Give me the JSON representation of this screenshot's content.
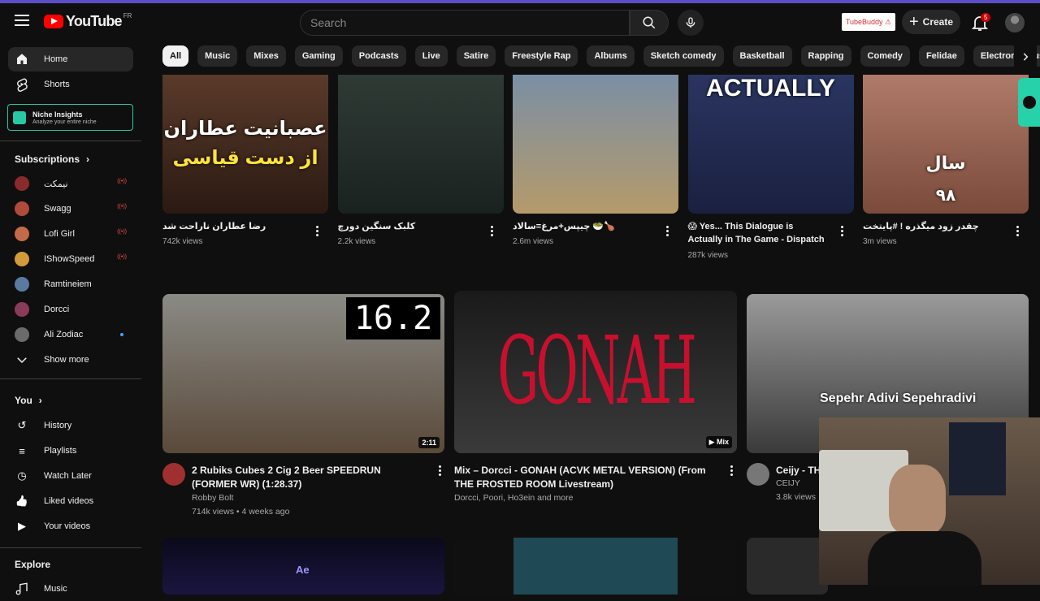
{
  "header": {
    "logo_text": "YouTube",
    "country": "FR",
    "search_placeholder": "Search",
    "tubebuddy_label": "TubeBuddy ⚠",
    "create_label": "Create",
    "notification_count": "5"
  },
  "sidebar": {
    "home": "Home",
    "shorts": "Shorts",
    "niche_title": "Niche Insights",
    "niche_subtitle": "Analyze your entire niche",
    "subscriptions_title": "Subscriptions",
    "subscriptions": [
      {
        "name": "نیمکت",
        "live": true,
        "color": "#8a2b2b"
      },
      {
        "name": "Swagg",
        "live": true,
        "color": "#b04a3a"
      },
      {
        "name": "Lofi Girl",
        "live": true,
        "color": "#c46a4a"
      },
      {
        "name": "IShowSpeed",
        "live": true,
        "color": "#d49b3a"
      },
      {
        "name": "Ramtineiem",
        "live": false,
        "color": "#5a7aa0"
      },
      {
        "name": "Dorcci",
        "live": false,
        "color": "#8b3b5a"
      },
      {
        "name": "Ali Zodiac",
        "live": false,
        "color": "#6b6b6b"
      }
    ],
    "show_more": "Show more",
    "you_title": "You",
    "you_items": [
      "History",
      "Playlists",
      "Watch Later",
      "Liked videos",
      "Your videos"
    ],
    "explore_title": "Explore",
    "explore_partial": "Music"
  },
  "chips": [
    "All",
    "Music",
    "Mixes",
    "Gaming",
    "Podcasts",
    "Live",
    "Satire",
    "Freestyle Rap",
    "Albums",
    "Sketch comedy",
    "Basketball",
    "Rapping",
    "Comedy",
    "Felidae",
    "Electronic Music"
  ],
  "shorts": [
    {
      "title": "رضا عطاران ناراحت شد",
      "views": "742k views",
      "thumb_text_1": "عصبانیت عطاران",
      "thumb_text_2": "از دست قیاسی",
      "thumb_bg": [
        "#5a3a2a",
        "#2a1a12"
      ]
    },
    {
      "title": "کلبک سنگین دورچ",
      "views": "2.2k views",
      "thumb_bg": [
        "#2f3a35",
        "#1a2220"
      ]
    },
    {
      "title": "چیپس+مرغ=سالاد 🥗🍗",
      "views": "2.6m views",
      "thumb_bg": [
        "#7a8fa5",
        "#b59a6a"
      ]
    },
    {
      "title": "😱 Yes... This Dialogue is Actually in The Game - Dispatch",
      "views": "287k views",
      "thumb_text_1": "ACTUALLY",
      "thumb_bg": [
        "#2a3560",
        "#1a2040"
      ]
    },
    {
      "title": "چقدر زود میگذره ! #پایتخت",
      "views": "3m views",
      "thumb_text_1": "سال",
      "thumb_text_2": "۹۸",
      "thumb_bg": [
        "#b07a6a",
        "#7a4a3a"
      ]
    }
  ],
  "videos": [
    {
      "title": "2 Rubiks Cubes 2 Cig 2 Beer SPEEDRUN (FORMER WR) (1:28.37)",
      "channel": "Robby Bolt",
      "meta": "714k views • 4 weeks ago",
      "duration": "2:11",
      "overlay": "16.2",
      "thumb_bg": [
        "#8a8a85",
        "#5a4a3a"
      ],
      "avatar_color": "#a03030"
    },
    {
      "title": "Mix – Dorcci - GONAH (ACVK METAL VERSION) (From THE FROSTED ROOM Livestream)",
      "channel": "Dorcci, Poori, Ho3ein and more",
      "badge": "Mix",
      "overlay": "GONAH",
      "thumb_bg": [
        "#1a1a1a",
        "#3a3a3a"
      ]
    },
    {
      "title": "Ceijy - TH",
      "channel": "CEIJY",
      "meta": "3.8k views",
      "overlay": "Sepehr Adivi  Sepehradivi",
      "thumb_bg": [
        "#9a9a9a",
        "#3a3a3a"
      ],
      "avatar_color": "#777"
    }
  ],
  "bottom_row_label": "Ae",
  "colors": {
    "accent": "#ff0000",
    "background": "#0f0f0f",
    "chip": "#272727",
    "niche": "#27c9a5"
  }
}
